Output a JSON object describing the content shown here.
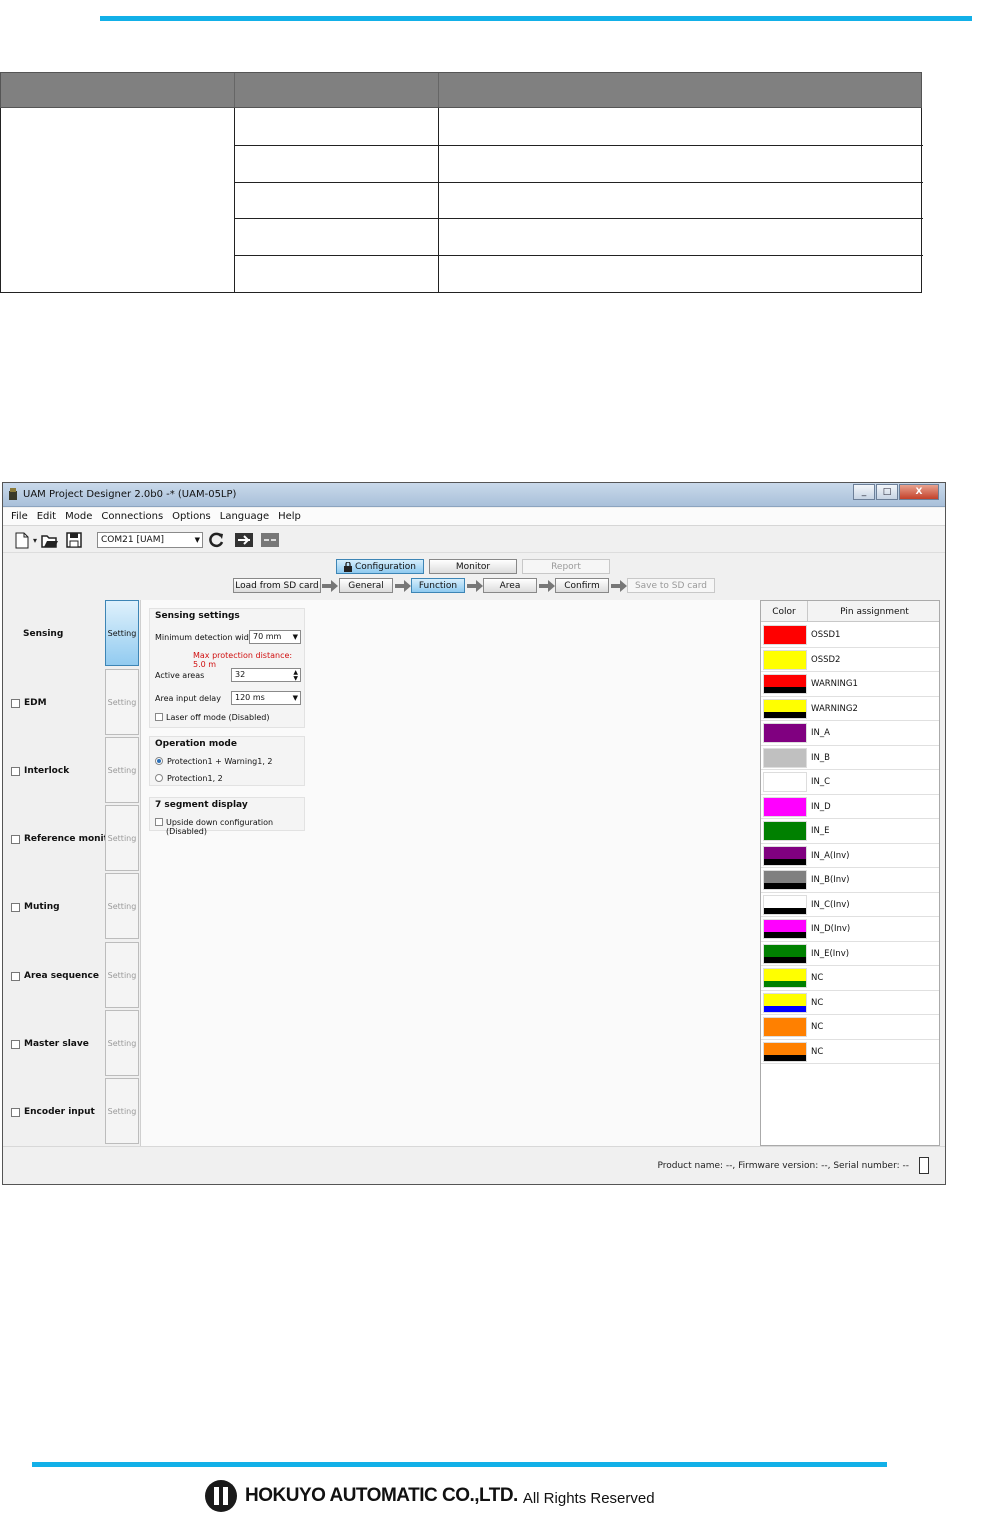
{
  "window": {
    "title": "UAM Project Designer 2.0b0 -* (UAM-05LP)",
    "buttons": [
      "_",
      "□",
      "X"
    ]
  },
  "menu": [
    "File",
    "Edit",
    "Mode",
    "Connections",
    "Options",
    "Language",
    "Help"
  ],
  "toolbar": {
    "port_value": "COM21 [UAM]",
    "icons": [
      "new-file-icon",
      "open-folder-icon",
      "save-icon",
      "refresh-icon",
      "connect-icon",
      "disconnect-icon"
    ]
  },
  "modes": {
    "configuration": "Configuration",
    "monitor": "Monitor",
    "report": "Report"
  },
  "flow": {
    "load": "Load from SD card",
    "general": "General",
    "function": "Function",
    "area": "Area",
    "confirm": "Confirm",
    "save": "Save to SD card"
  },
  "nav": [
    {
      "label": "Sensing",
      "setting": "Setting",
      "checkbox": false,
      "active": true
    },
    {
      "label": "EDM",
      "setting": "Setting",
      "checkbox": true,
      "active": false
    },
    {
      "label": "Interlock",
      "setting": "Setting",
      "checkbox": true,
      "active": false
    },
    {
      "label": "Reference monitor",
      "setting": "Setting",
      "checkbox": true,
      "active": false
    },
    {
      "label": "Muting",
      "setting": "Setting",
      "checkbox": true,
      "active": false
    },
    {
      "label": "Area sequence",
      "setting": "Setting",
      "checkbox": true,
      "active": false
    },
    {
      "label": "Master slave",
      "setting": "Setting",
      "checkbox": true,
      "active": false
    },
    {
      "label": "Encoder input",
      "setting": "Setting",
      "checkbox": true,
      "active": false
    }
  ],
  "sensing": {
    "title": "Sensing settings",
    "min_width_label": "Minimum detection width",
    "min_width_value": "70 mm",
    "max_protection": "Max protection distance: 5.0 m",
    "active_areas_label": "Active areas",
    "active_areas_value": "32",
    "delay_label": "Area input delay",
    "delay_value": "120 ms",
    "laser_off": "Laser off mode (Disabled)"
  },
  "operation": {
    "title": "Operation mode",
    "opt1": "Protection1 + Warning1, 2",
    "opt2": "Protection1, 2"
  },
  "segment": {
    "title": "7 segment display",
    "upside": "Upside down configuration (Disabled)"
  },
  "pins": {
    "header_color": "Color",
    "header_assign": "Pin assignment",
    "rows": [
      {
        "label": "OSSD1",
        "top": "#ff0000",
        "bottom": "#ff0000"
      },
      {
        "label": "OSSD2",
        "top": "#ffff00",
        "bottom": "#ffff00"
      },
      {
        "label": "WARNING1",
        "top": "#ff0000",
        "bottom": "#000000"
      },
      {
        "label": "WARNING2",
        "top": "#ffff00",
        "bottom": "#000000"
      },
      {
        "label": "IN_A",
        "top": "#800080",
        "bottom": "#800080"
      },
      {
        "label": "IN_B",
        "top": "#c0c0c0",
        "bottom": "#c0c0c0"
      },
      {
        "label": "IN_C",
        "top": "#ffffff",
        "bottom": "#ffffff"
      },
      {
        "label": "IN_D",
        "top": "#ff00ff",
        "bottom": "#ff00ff"
      },
      {
        "label": "IN_E",
        "top": "#008000",
        "bottom": "#008000"
      },
      {
        "label": "IN_A(Inv)",
        "top": "#800080",
        "bottom": "#000000"
      },
      {
        "label": "IN_B(Inv)",
        "top": "#808080",
        "bottom": "#000000"
      },
      {
        "label": "IN_C(Inv)",
        "top": "#ffffff",
        "bottom": "#000000"
      },
      {
        "label": "IN_D(Inv)",
        "top": "#ff00ff",
        "bottom": "#000000"
      },
      {
        "label": "IN_E(Inv)",
        "top": "#008000",
        "bottom": "#000000"
      },
      {
        "label": "NC",
        "top": "#ffff00",
        "bottom": "#008000"
      },
      {
        "label": "NC",
        "top": "#ffff00",
        "bottom": "#0000ff"
      },
      {
        "label": "NC",
        "top": "#ff8000",
        "bottom": "#ff8000"
      },
      {
        "label": "NC",
        "top": "#ff8000",
        "bottom": "#000000"
      }
    ]
  },
  "status": "Product name: --, Firmware version: --, Serial number: --",
  "footer": {
    "brand": "HOKUYO AUTOMATIC CO.,LTD.",
    "rights": "All Rights Reserved"
  },
  "colors": {
    "accent_rule": "#12b0e8",
    "active_button": "#8fcaf0",
    "warning_text": "#d01010"
  }
}
